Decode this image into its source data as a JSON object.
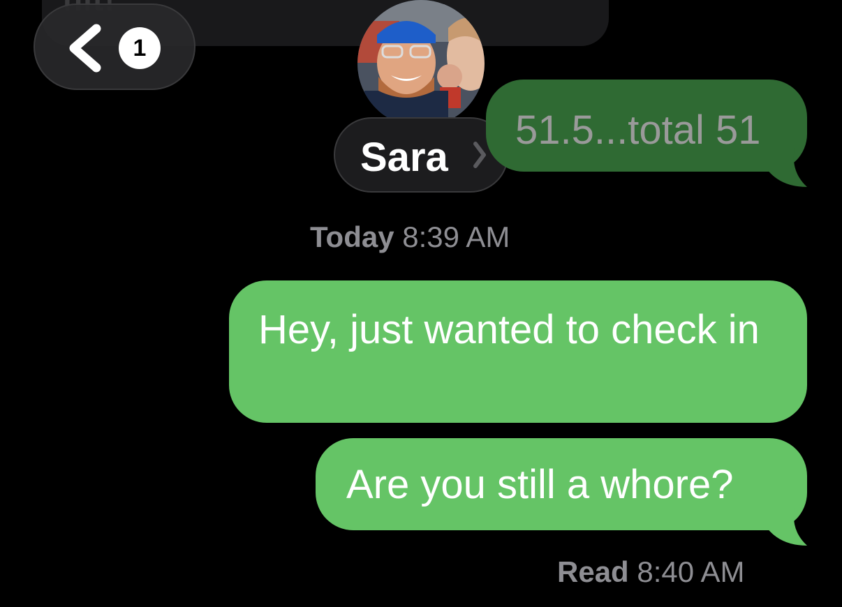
{
  "previous_message": {
    "partial_text": "nit!"
  },
  "header": {
    "back_badge_count": "1",
    "contact_name": "Sara"
  },
  "messages": [
    {
      "text": "51.5...total 51",
      "status": "dimmed"
    },
    {
      "text": "Hey, just wanted to check in"
    },
    {
      "text": "Are you still a whore?"
    }
  ],
  "timestamps": {
    "day_label": "Today",
    "time_label": "8:39 AM"
  },
  "read_receipt": {
    "label": "Read",
    "time": "8:40 AM"
  },
  "colors": {
    "outgoing_bubble": "#65c466",
    "background": "#000000"
  }
}
